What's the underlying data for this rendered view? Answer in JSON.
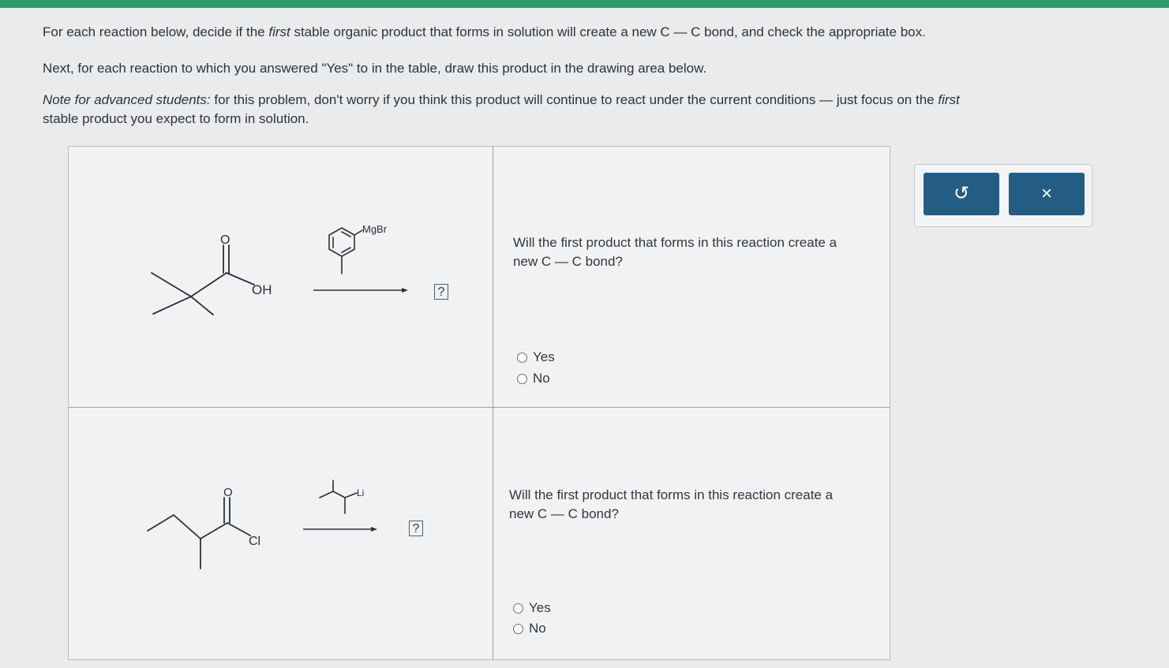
{
  "instructions": {
    "line1_pre": "For each reaction below, decide if the ",
    "line1_em": "first",
    "line1_post": " stable organic product that forms in solution will create a new C — C bond, and check the appropriate box.",
    "line2": "Next, for each reaction to which you answered \"Yes\" to in the table, draw this product in the drawing area below.",
    "line3_em": "Note for advanced students:",
    "line3_post": " for this problem, don't worry if you think this product will continue to react under the current conditions — just focus on the ",
    "line3_em2": "first",
    "line4": "stable product you expect to form in solution."
  },
  "reactions": [
    {
      "reactant_labels": {
        "oxygen": "O",
        "hydroxyl": "OH"
      },
      "reagent_label": "MgBr",
      "product_placeholder": "?",
      "question": "Will the first product that forms in this reaction create a new C — C bond?",
      "options": [
        "Yes",
        "No"
      ],
      "selected": null
    },
    {
      "reactant_labels": {
        "oxygen": "O",
        "chlorine": "Cl"
      },
      "reagent_label": "Li",
      "product_placeholder": "?",
      "question": "Will the first product that forms in this reaction create a new C — C bond?",
      "options": [
        "Yes",
        "No"
      ],
      "selected": null
    }
  ],
  "toolbar": {
    "undo_icon": "↺",
    "close_icon": "×"
  },
  "colors": {
    "accent_green": "#2f9a6a",
    "button_blue": "#245d84"
  }
}
